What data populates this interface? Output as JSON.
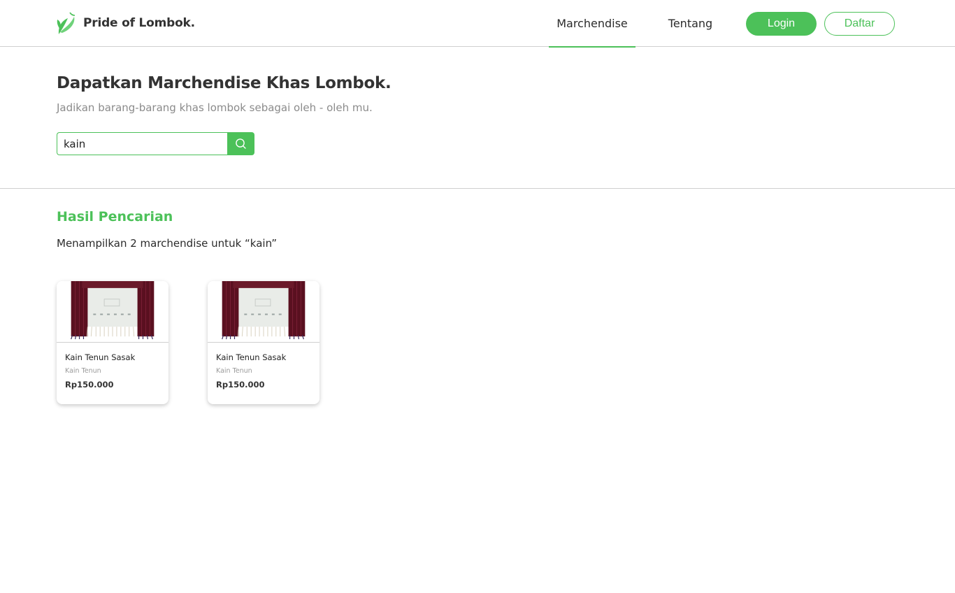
{
  "brand": {
    "name": "Pride of Lombok.",
    "logo_icon": "leaf-logo-icon",
    "accent_color": "#4cc159"
  },
  "nav": {
    "items": [
      {
        "label": "Marchendise",
        "active": true
      },
      {
        "label": "Tentang",
        "active": false
      }
    ],
    "login_label": "Login",
    "register_label": "Daftar"
  },
  "hero": {
    "title": "Dapatkan Marchendise Khas Lombok.",
    "subtitle": "Jadikan barang-barang khas lombok sebagai oleh - oleh mu."
  },
  "search": {
    "value": "kain",
    "icon": "search-icon"
  },
  "results": {
    "title": "Hasil Pencarian",
    "summary": "Menampilkan 2 marchendise untuk “kain”",
    "items": [
      {
        "name": "Kain Tenun Sasak",
        "category": "Kain Tenun",
        "price": "Rp150.000",
        "image_icon": "woven-cloth-image"
      },
      {
        "name": "Kain Tenun Sasak",
        "category": "Kain Tenun",
        "price": "Rp150.000",
        "image_icon": "woven-cloth-image"
      }
    ]
  }
}
